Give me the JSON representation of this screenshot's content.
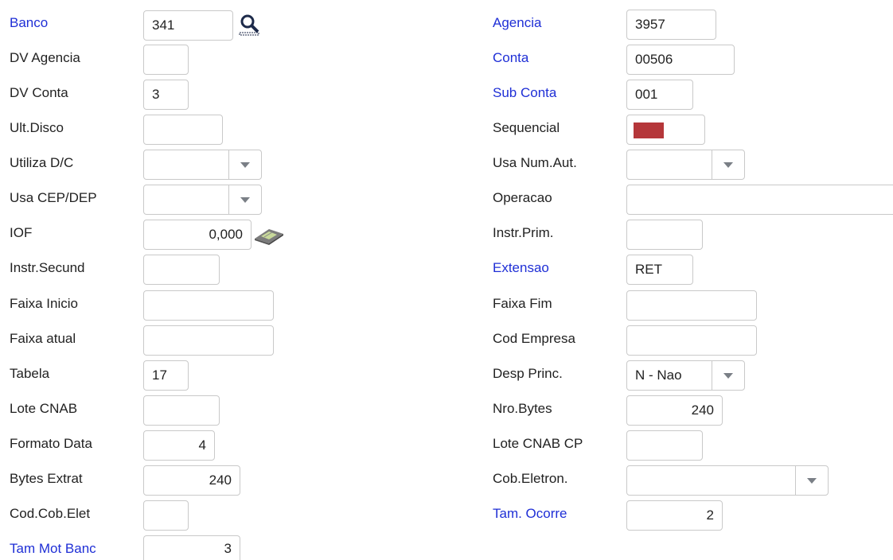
{
  "left": {
    "banco": {
      "label": "Banco",
      "value": "341",
      "required": true
    },
    "dv_agencia": {
      "label": "DV Agencia",
      "value": ""
    },
    "dv_conta": {
      "label": "DV Conta",
      "value": "3"
    },
    "ult_disco": {
      "label": "Ult.Disco",
      "value": ""
    },
    "utiliza_dc": {
      "label": "Utiliza D/C",
      "value": ""
    },
    "usa_cep_dep": {
      "label": "Usa CEP/DEP",
      "value": ""
    },
    "iof": {
      "label": "IOF",
      "value": "0,000"
    },
    "instr_secund": {
      "label": "Instr.Secund",
      "value": ""
    },
    "faixa_inicio": {
      "label": "Faixa Inicio",
      "value": ""
    },
    "faixa_atual": {
      "label": "Faixa atual",
      "value": ""
    },
    "tabela": {
      "label": "Tabela",
      "value": "17"
    },
    "lote_cnab": {
      "label": "Lote CNAB",
      "value": ""
    },
    "formato_data": {
      "label": "Formato Data",
      "value": "4"
    },
    "bytes_extrat": {
      "label": "Bytes Extrat",
      "value": "240"
    },
    "cod_cob_elet": {
      "label": "Cod.Cob.Elet",
      "value": ""
    },
    "tam_mot_banc": {
      "label": "Tam Mot Banc",
      "value": "3",
      "required": true
    }
  },
  "right": {
    "agencia": {
      "label": "Agencia",
      "value": "3957",
      "required": true
    },
    "conta": {
      "label": "Conta",
      "value": "00506",
      "required": true
    },
    "sub_conta": {
      "label": "Sub Conta",
      "value": "001",
      "required": true
    },
    "sequencial": {
      "label": "Sequencial",
      "color": "#b5373a"
    },
    "usa_num_aut": {
      "label": "Usa Num.Aut.",
      "value": ""
    },
    "operacao": {
      "label": "Operacao",
      "value": ""
    },
    "instr_prim": {
      "label": "Instr.Prim.",
      "value": ""
    },
    "extensao": {
      "label": "Extensao",
      "value": "RET",
      "required": true
    },
    "faixa_fim": {
      "label": "Faixa Fim",
      "value": ""
    },
    "cod_empresa": {
      "label": "Cod Empresa",
      "value": ""
    },
    "desp_princ": {
      "label": "Desp Princ.",
      "value": "N - Nao"
    },
    "nro_bytes": {
      "label": "Nro.Bytes",
      "value": "240"
    },
    "lote_cnab_cp": {
      "label": "Lote CNAB CP",
      "value": ""
    },
    "cob_eletron": {
      "label": "Cob.Eletron.",
      "value": ""
    },
    "tam_ocorre": {
      "label": "Tam. Ocorre",
      "value": "2",
      "required": true
    }
  },
  "icons": {
    "lookup": "magnifier-icon",
    "calculator": "calculator-icon"
  },
  "colors": {
    "required_label": "#1f2fd6",
    "label": "#222222",
    "border": "#c9c9c9"
  }
}
